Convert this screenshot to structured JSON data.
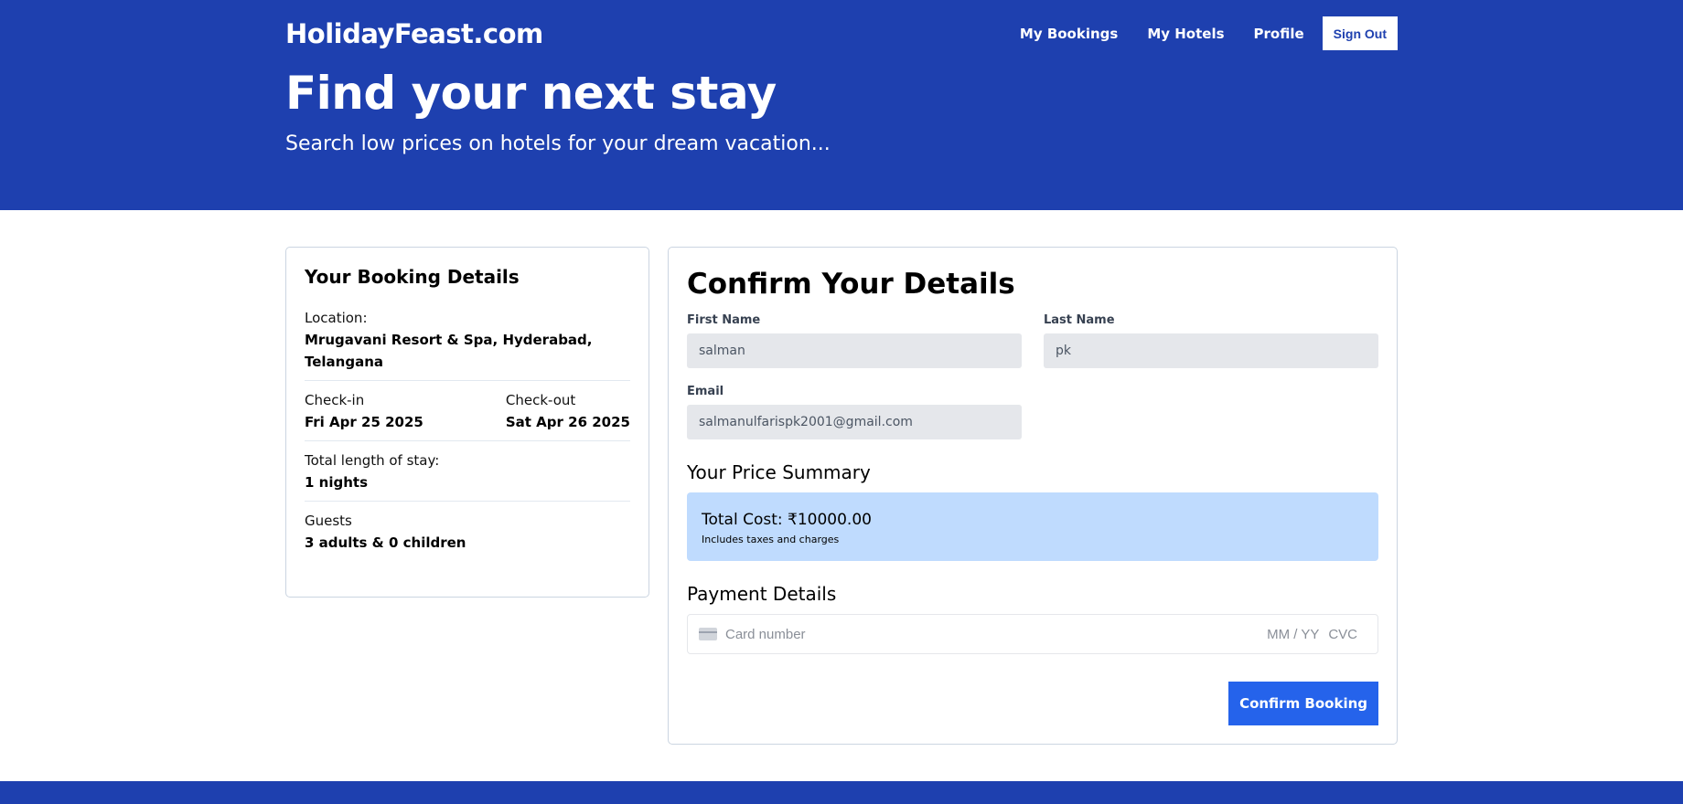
{
  "header": {
    "logo": "HolidayFeast.com",
    "nav": {
      "my_bookings": "My Bookings",
      "my_hotels": "My Hotels",
      "profile": "Profile",
      "sign_out": "Sign Out"
    },
    "hero_title": "Find your next stay",
    "hero_subtitle": "Search low prices on hotels for your dream vacation..."
  },
  "booking": {
    "title": "Your Booking Details",
    "location_label": "Location:",
    "location_value": "Mrugavani Resort & Spa, Hyderabad, Telangana",
    "checkin_label": "Check-in",
    "checkin_value": "Fri Apr 25 2025",
    "checkout_label": "Check-out",
    "checkout_value": "Sat Apr 26 2025",
    "length_label": "Total length of stay:",
    "length_value": "1 nights",
    "guests_label": "Guests",
    "guests_value": "3 adults & 0 children"
  },
  "confirm": {
    "title": "Confirm Your Details",
    "first_name_label": "First Name",
    "first_name_value": "salman",
    "last_name_label": "Last Name",
    "last_name_value": "pk",
    "email_label": "Email",
    "email_value": "salmanulfarispk2001@gmail.com",
    "price_summary_title": "Your Price Summary",
    "total_cost": "Total Cost: ₹10000.00",
    "total_note": "Includes taxes and charges",
    "payment_title": "Payment Details",
    "card_placeholder": "Card number",
    "expiry_placeholder": "MM / YY",
    "cvc_placeholder": "CVC",
    "button": "Confirm Booking"
  },
  "colors": {
    "brand": "#1e40af",
    "button": "#2563eb",
    "price_bg": "#bfdbfe"
  }
}
